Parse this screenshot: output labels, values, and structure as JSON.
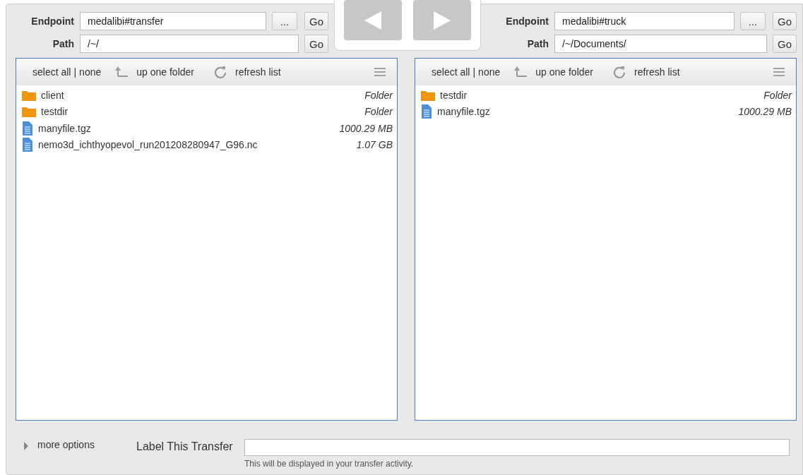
{
  "panes": [
    {
      "endpoint_label": "Endpoint",
      "endpoint": "medalibi#transfer",
      "browse_button": "...",
      "endpoint_go": "Go",
      "path_label": "Path",
      "path": "/~/",
      "path_go": "Go",
      "toolbar": {
        "select_all": "select all",
        "separator": "|",
        "none": "none",
        "up": "up one folder",
        "refresh": "refresh list"
      },
      "files": [
        {
          "kind": "folder",
          "name": "client",
          "size": "Folder"
        },
        {
          "kind": "folder",
          "name": "testdir",
          "size": "Folder"
        },
        {
          "kind": "file",
          "name": "manyfile.tgz",
          "size": "1000.29 MB"
        },
        {
          "kind": "file",
          "name": "nemo3d_ichthyopevol_run201208280947_G96.nc",
          "size": "1.07 GB"
        }
      ]
    },
    {
      "endpoint_label": "Endpoint",
      "endpoint": "medalibi#truck",
      "browse_button": "...",
      "endpoint_go": "Go",
      "path_label": "Path",
      "path": "/~/Documents/",
      "path_go": "Go",
      "toolbar": {
        "select_all": "select all",
        "separator": "|",
        "none": "none",
        "up": "up one folder",
        "refresh": "refresh list"
      },
      "files": [
        {
          "kind": "folder",
          "name": "testdir",
          "size": "Folder"
        },
        {
          "kind": "file",
          "name": "manyfile.tgz",
          "size": "1000.29 MB"
        }
      ]
    }
  ],
  "footer": {
    "more_options": "more options",
    "expanded": false,
    "label_title": "Label This Transfer",
    "label_hint": "This will be displayed in your transfer activity."
  }
}
